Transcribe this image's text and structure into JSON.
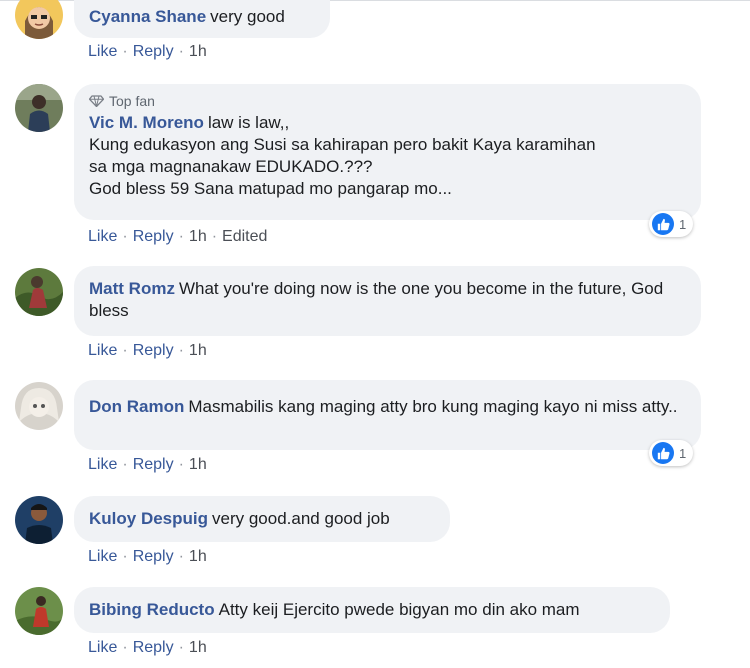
{
  "action_labels": {
    "like": "Like",
    "reply": "Reply",
    "separator": "·"
  },
  "comments": [
    {
      "name": "Cyanna Shane",
      "text": "very good",
      "time": "1h",
      "avatar_icon": "avatar-cartoon-icon"
    },
    {
      "badge": "Top fan",
      "badge_icon": "diamond-icon",
      "name": "Vic M. Moreno",
      "text_line1": "law is law,,",
      "text_line2": "Kung edukasyon ang Susi sa kahirapan pero bakit Kaya karamihan",
      "text_line3": "sa mga magnanakaw EDUKADO.???",
      "text_line4": "God bless 59 Sana matupad mo pangarap mo...",
      "time": "1h",
      "edited": "Edited",
      "reactions": {
        "icon": "like-reaction-icon",
        "count": "1"
      }
    },
    {
      "name": "Matt Romz",
      "text": "What you're doing now is the one you become in the future, God bless",
      "time": "1h"
    },
    {
      "name": "Don Ramon",
      "text": "Masmabilis kang maging atty bro kung maging kayo ni miss atty..",
      "time": "1h",
      "reactions": {
        "icon": "like-reaction-icon",
        "count": "1"
      }
    },
    {
      "name": "Kuloy Despuig",
      "text": "very good.and good job",
      "time": "1h"
    },
    {
      "name": "Bibing Reducto",
      "text": "Atty keij Ejercito pwede bigyan mo din ako mam",
      "time": "1h"
    }
  ],
  "colors": {
    "name": "#385898",
    "bubble": "#f0f2f5",
    "like_blue": "#1877f2"
  }
}
